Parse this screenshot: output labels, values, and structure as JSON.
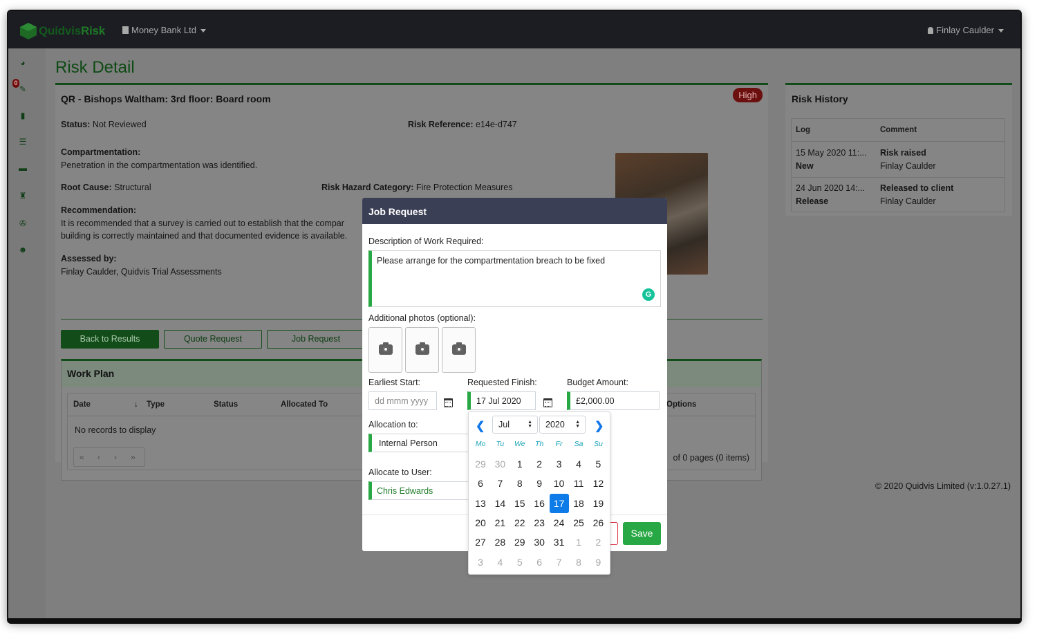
{
  "nav": {
    "logo_a": "Quidvis",
    "logo_b": "Risk",
    "org": "Money Bank Ltd",
    "user": "Finlay Caulder"
  },
  "sidebar": {
    "alert_count": "0",
    "icons": [
      "dashboard-icon",
      "wrench-alert-icon",
      "book-icon",
      "list-icon",
      "briefcase-icon",
      "fire-extinguisher-icon",
      "tools-icon",
      "users-icon"
    ]
  },
  "page": {
    "title": "Risk Detail"
  },
  "risk": {
    "title": "QR - Bishops Waltham: 3rd floor: Board room",
    "severity": "High",
    "status_label": "Status:",
    "status_value": "Not Reviewed",
    "reference_label": "Risk Reference:",
    "reference_value": "e14e-d747",
    "compartmentation_label": "Compartmentation:",
    "compartmentation_value": "Penetration in the compartmentation was identified.",
    "root_cause_label": "Root Cause:",
    "root_cause_value": "Structural",
    "hazard_label": "Risk Hazard Category:",
    "hazard_value": "Fire Protection Measures",
    "recommendation_label": "Recommendation:",
    "recommendation_line1": "It is recommended that a survey is carried out to establish that the compar",
    "recommendation_line2": "building is correctly maintained and that documented evidence is available.",
    "assessed_label": "Assessed by:",
    "assessed_value": "Finlay Caulder, Quidvis Trial Assessments",
    "buttons": {
      "back": "Back to Results",
      "quote": "Quote Request",
      "job": "Job Request"
    }
  },
  "work_plan": {
    "title": "Work Plan",
    "columns": [
      "Date",
      "Type",
      "Status",
      "Allocated To",
      "Options"
    ],
    "empty": "No records to display",
    "pager": [
      "«",
      "‹",
      "›",
      "»"
    ],
    "pages_text": "of 0 pages (0 items)"
  },
  "history": {
    "title": "Risk History",
    "columns": [
      "Log",
      "Comment"
    ],
    "rows": [
      {
        "date": "15 May 2020 11:...",
        "type": "New",
        "comment": "Risk raised",
        "by": "Finlay Caulder"
      },
      {
        "date": "24 Jun 2020 14:...",
        "type": "Release",
        "comment": "Released to client",
        "by": "Finlay Caulder"
      }
    ]
  },
  "footer": {
    "copyright": "© 2020 Quidvis Limited (v:1.0.27.1)"
  },
  "modal": {
    "title": "Job Request",
    "description_label": "Description of Work Required:",
    "description_value": "Please arrange for the compartmentation breach to be fixed",
    "photos_label": "Additional photos (optional):",
    "earliest_label": "Earliest Start:",
    "earliest_placeholder": "dd mmm yyyy",
    "finish_label": "Requested Finish:",
    "finish_value": "17 Jul 2020",
    "budget_label": "Budget Amount:",
    "budget_value": "£2,000.00",
    "allocation_label": "Allocation to:",
    "allocation_value": "Internal Person",
    "allocate_user_label": "Allocate to User:",
    "allocate_user_value": "Chris Edwards",
    "save": "Save"
  },
  "datepicker": {
    "month": "Jul",
    "year": "2020",
    "weekdays": [
      "Mo",
      "Tu",
      "We",
      "Th",
      "Fr",
      "Sa",
      "Su"
    ],
    "weeks": [
      [
        "29",
        "30",
        "1",
        "2",
        "3",
        "4",
        "5"
      ],
      [
        "6",
        "7",
        "8",
        "9",
        "10",
        "11",
        "12"
      ],
      [
        "13",
        "14",
        "15",
        "16",
        "17",
        "18",
        "19"
      ],
      [
        "20",
        "21",
        "22",
        "23",
        "24",
        "25",
        "26"
      ],
      [
        "27",
        "28",
        "29",
        "30",
        "31",
        "1",
        "2"
      ],
      [
        "3",
        "4",
        "5",
        "6",
        "7",
        "8",
        "9"
      ]
    ],
    "selected": "17",
    "colors": {
      "accent": "#0d7be8",
      "weekday": "#17a2b8"
    }
  },
  "colors": {
    "brand_green": "#28a745",
    "nav_bg": "#1b1d23",
    "modal_head": "#3b3f55",
    "danger": "#dc3545"
  }
}
